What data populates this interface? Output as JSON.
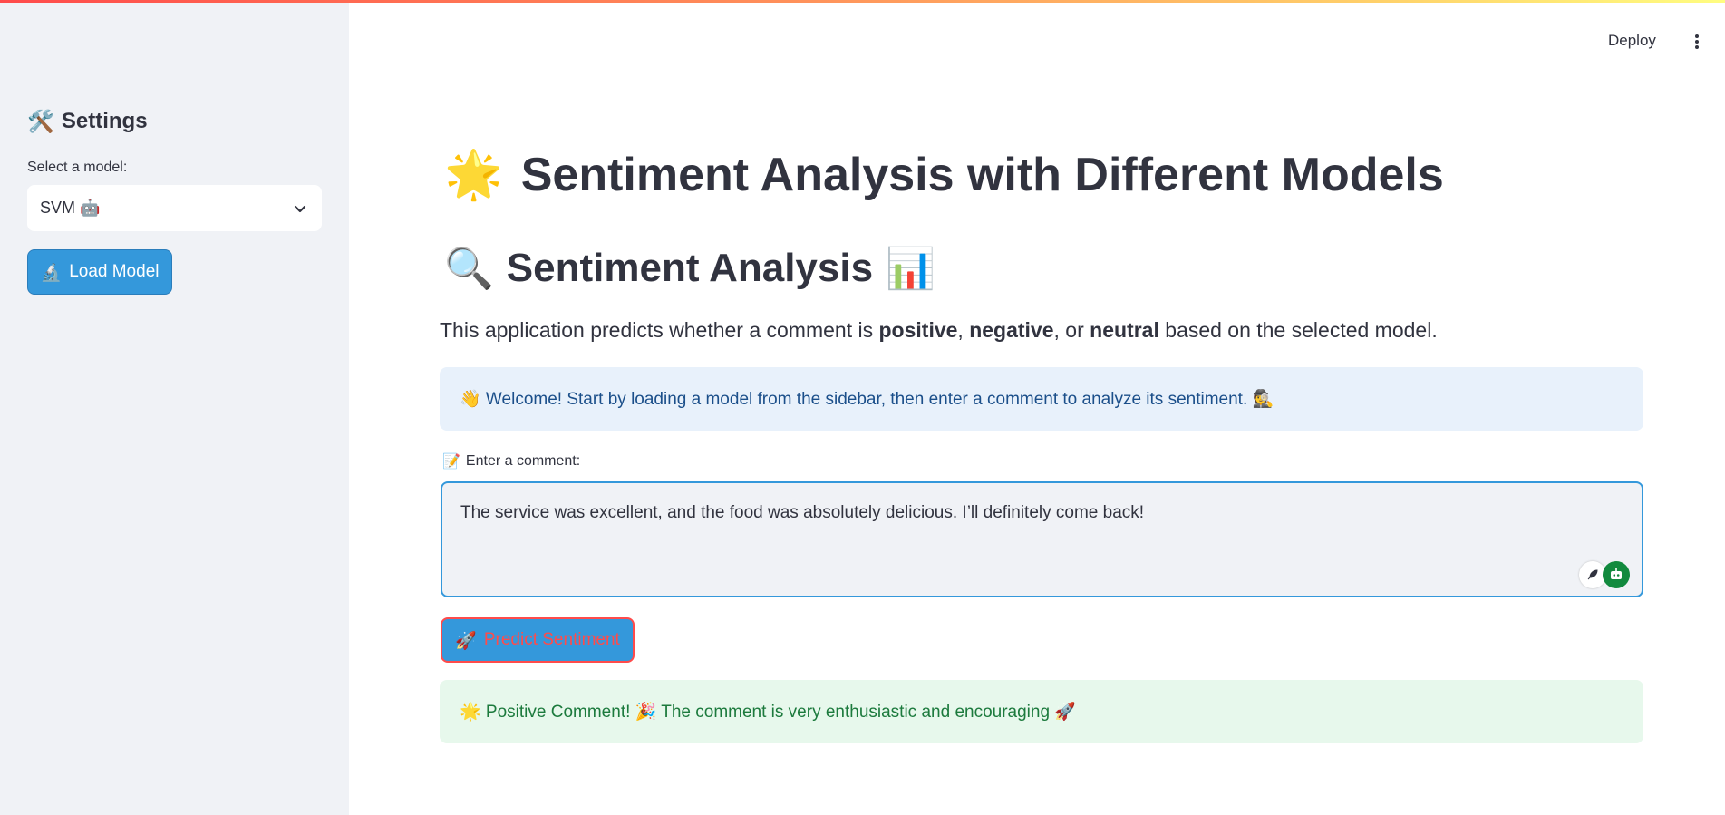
{
  "sidebar": {
    "title_icon": "🛠️",
    "title": "Settings",
    "select_label": "Select a model:",
    "select_value": "SVM 🤖",
    "load_button_icon": "🔬",
    "load_button": "Load Model"
  },
  "header": {
    "deploy": "Deploy"
  },
  "main": {
    "title_icon": "🌟",
    "title": "Sentiment Analysis with Different Models",
    "subtitle_icon_left": "🔍",
    "subtitle": "Sentiment Analysis",
    "subtitle_icon_right": "📊",
    "description_prefix": "This application predicts whether a comment is ",
    "positive": "positive",
    "comma": ", ",
    "negative": "negative",
    "or": ", or ",
    "neutral": "neutral",
    "description_suffix": " based on the selected model.",
    "info_message": "👋 Welcome! Start by loading a model from the sidebar, then enter a comment to analyze its sentiment. 🕵️",
    "input_label_icon": "📝",
    "input_label": "Enter a comment:",
    "input_value": "The service was excellent, and the food was absolutely delicious. I’ll definitely come back!",
    "predict_button_icon": "🚀",
    "predict_button": "Predict Sentiment",
    "result_message": "🌟 Positive Comment! 🎉 The comment is very enthusiastic and encouraging 🚀"
  },
  "colors": {
    "accent_blue": "#3498db",
    "accent_red": "#ff4b4b",
    "sidebar_bg": "#f0f2f6",
    "info_bg": "#e8f1fb",
    "success_bg": "#e7f8ec"
  }
}
